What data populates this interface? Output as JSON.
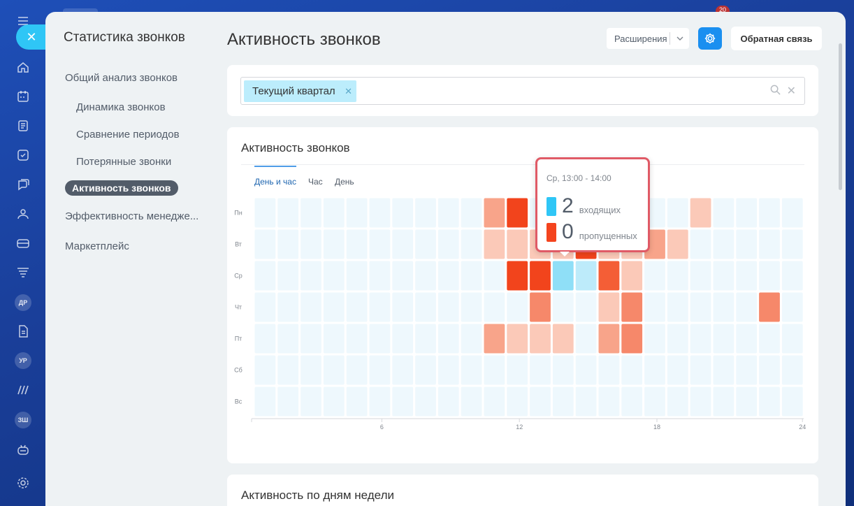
{
  "sidebar": {
    "title": "Статистика звонков",
    "items": [
      {
        "label": "Общий анализ звонков",
        "level": 0,
        "active": false
      },
      {
        "label": "Динамика звонков",
        "level": 1,
        "active": false
      },
      {
        "label": "Сравнение периодов",
        "level": 1,
        "active": false
      },
      {
        "label": "Потерянные звонки",
        "level": 1,
        "active": false
      },
      {
        "label": "Активность звонков",
        "level": 1,
        "active": true
      },
      {
        "label": "Эффективность менедже...",
        "level": 0,
        "active": false
      },
      {
        "label": "Маркетплейс",
        "level": 0,
        "active": false
      }
    ]
  },
  "rail": {
    "avatars": [
      "ДР",
      "УР",
      "ЗШ"
    ],
    "notification_count": "20"
  },
  "header": {
    "title": "Активность звонков",
    "extensions_label": "Расширения",
    "feedback_label": "Обратная связь"
  },
  "filter": {
    "chip_label": "Текущий квартал"
  },
  "chart_card": {
    "title": "Активность звонков",
    "tabs": [
      "День и час",
      "Час",
      "День"
    ],
    "active_tab": 0
  },
  "tooltip": {
    "header": "Ср, 13:00 - 14:00",
    "incoming_value": "2",
    "incoming_label": "входящих",
    "missed_value": "0",
    "missed_label": "пропущенных"
  },
  "bottom_card": {
    "title": "Активность по дням недели"
  },
  "colors": {
    "incoming": "#2fc6f6",
    "missed": "#f4441e",
    "empty_cell": "#eef8fd",
    "accent": "#1a8ff0"
  },
  "chart_data": {
    "type": "heatmap",
    "title": "Активность звонков",
    "days": [
      "Пн",
      "Вт",
      "Ср",
      "Чт",
      "Пт",
      "Сб",
      "Вс"
    ],
    "hours": [
      0,
      1,
      2,
      3,
      4,
      5,
      6,
      7,
      8,
      9,
      10,
      11,
      12,
      13,
      14,
      15,
      16,
      17,
      18,
      19,
      20,
      21,
      22,
      23
    ],
    "x_ticks": [
      6,
      12,
      18,
      24
    ],
    "xlim": [
      0,
      24
    ],
    "cells": [
      {
        "day": 0,
        "hour": 10,
        "level": 2,
        "kind": "missed"
      },
      {
        "day": 0,
        "hour": 11,
        "level": 5,
        "kind": "missed"
      },
      {
        "day": 0,
        "hour": 19,
        "level": 1,
        "kind": "missed"
      },
      {
        "day": 1,
        "hour": 10,
        "level": 1,
        "kind": "missed"
      },
      {
        "day": 1,
        "hour": 11,
        "level": 1,
        "kind": "missed"
      },
      {
        "day": 1,
        "hour": 12,
        "level": 1,
        "kind": "missed"
      },
      {
        "day": 1,
        "hour": 13,
        "level": 1,
        "kind": "missed"
      },
      {
        "day": 1,
        "hour": 14,
        "level": 5,
        "kind": "missed"
      },
      {
        "day": 1,
        "hour": 15,
        "level": 1,
        "kind": "missed"
      },
      {
        "day": 1,
        "hour": 16,
        "level": 1,
        "kind": "missed"
      },
      {
        "day": 1,
        "hour": 17,
        "level": 2,
        "kind": "missed"
      },
      {
        "day": 1,
        "hour": 18,
        "level": 1,
        "kind": "missed"
      },
      {
        "day": 2,
        "hour": 11,
        "level": 5,
        "kind": "missed"
      },
      {
        "day": 2,
        "hour": 12,
        "level": 5,
        "kind": "missed"
      },
      {
        "day": 2,
        "hour": 13,
        "level": 2,
        "kind": "incoming"
      },
      {
        "day": 2,
        "hour": 14,
        "level": 1,
        "kind": "incoming"
      },
      {
        "day": 2,
        "hour": 15,
        "level": 4,
        "kind": "missed"
      },
      {
        "day": 2,
        "hour": 16,
        "level": 1,
        "kind": "missed"
      },
      {
        "day": 3,
        "hour": 12,
        "level": 3,
        "kind": "missed"
      },
      {
        "day": 3,
        "hour": 15,
        "level": 1,
        "kind": "missed"
      },
      {
        "day": 3,
        "hour": 16,
        "level": 3,
        "kind": "missed"
      },
      {
        "day": 3,
        "hour": 22,
        "level": 3,
        "kind": "missed"
      },
      {
        "day": 4,
        "hour": 10,
        "level": 2,
        "kind": "missed"
      },
      {
        "day": 4,
        "hour": 11,
        "level": 1,
        "kind": "missed"
      },
      {
        "day": 4,
        "hour": 12,
        "level": 1,
        "kind": "missed"
      },
      {
        "day": 4,
        "hour": 13,
        "level": 1,
        "kind": "missed"
      },
      {
        "day": 4,
        "hour": 15,
        "level": 2,
        "kind": "missed"
      },
      {
        "day": 4,
        "hour": 16,
        "level": 3,
        "kind": "missed"
      }
    ],
    "tooltip_cell": {
      "day": 2,
      "hour": 13,
      "incoming": 2,
      "missed": 0
    }
  }
}
